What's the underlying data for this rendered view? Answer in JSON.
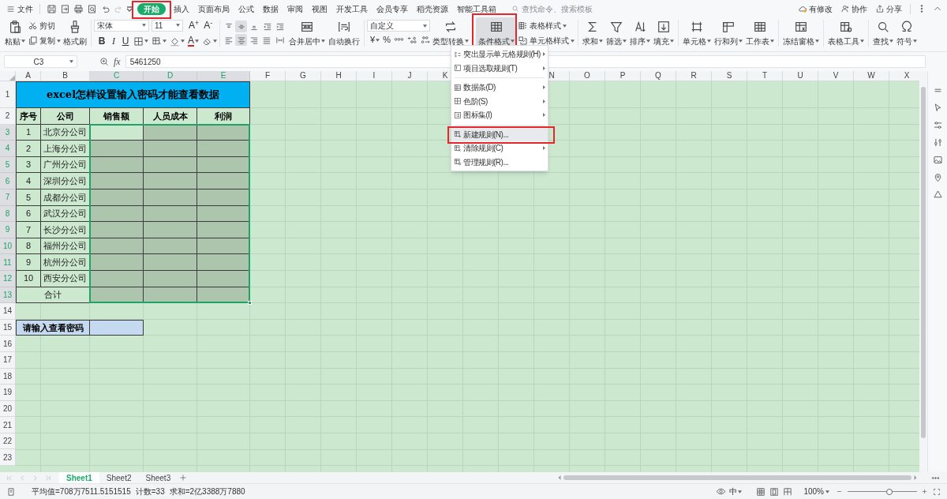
{
  "menu": {
    "file": "文件",
    "tabs": [
      {
        "label": "开始",
        "selected": true,
        "marked": true
      },
      {
        "label": "插入",
        "selected": false,
        "marked": false
      },
      {
        "label": "页面布局",
        "selected": false,
        "marked": false
      },
      {
        "label": "公式",
        "selected": false,
        "marked": false
      },
      {
        "label": "数据",
        "selected": false,
        "marked": false
      },
      {
        "label": "审阅",
        "selected": false,
        "marked": false
      },
      {
        "label": "视图",
        "selected": false,
        "marked": false
      },
      {
        "label": "开发工具",
        "selected": false,
        "marked": false
      },
      {
        "label": "会员专享",
        "selected": false,
        "marked": false
      },
      {
        "label": "稻壳资源",
        "selected": false,
        "marked": false
      },
      {
        "label": "智能工具箱",
        "selected": false,
        "marked": false
      }
    ],
    "search": {
      "placeholder": "查找命令、搜索模板"
    },
    "right": [
      "有修改",
      "协作",
      "分享"
    ]
  },
  "ribbon": {
    "paste": "粘贴",
    "cut": "剪切",
    "copy": "复制",
    "format_painter": "格式刷",
    "font": "宋体",
    "font_size": "11",
    "grow_font": "A$^{+}$",
    "shrink_font": "A$^{-}$",
    "bold": "B",
    "italic": "I",
    "underline": "U",
    "font_color": "A",
    "vertical_align": [
      {
        "selected": false
      },
      {
        "selected": true
      },
      {
        "selected": false
      }
    ],
    "horizontal_align": [
      {
        "selected": false
      },
      {
        "selected": true
      },
      {
        "selected": false
      },
      {
        "selected": false
      }
    ],
    "merge": "合并居中",
    "wrap": "自动换行",
    "number_format": "自定义",
    "currency": "¥",
    "percent": "%",
    "convert": "类型转换",
    "conditional": {
      "label": "条件格式",
      "expanded": true,
      "marked": true
    },
    "table_style": "表格样式",
    "cell_style": "单元格样式",
    "sum": "求和",
    "filter": "筛选",
    "sort": "排序",
    "fill": "填充",
    "cells": "单元格",
    "rows_cols": "行和列",
    "worksheet": "工作表",
    "freeze": "冻结窗格",
    "table_tools": "表格工具",
    "find": "查找",
    "symbol": "符号"
  },
  "formula_bar": {
    "name_box": "C3",
    "fx": "fx",
    "value": "5461250"
  },
  "sheet": {
    "columns": [
      {
        "kind": "column",
        "label": "A",
        "selected": false
      },
      {
        "kind": "column",
        "label": "B",
        "selected": false
      },
      {
        "kind": "column",
        "label": "C",
        "selected": true
      },
      {
        "kind": "column",
        "label": "D",
        "selected": true
      },
      {
        "kind": "column",
        "label": "E",
        "selected": true
      },
      {
        "kind": "column",
        "label": "F",
        "selected": false
      },
      {
        "kind": "column",
        "label": "G",
        "selected": false
      },
      {
        "kind": "column",
        "label": "H",
        "selected": false
      },
      {
        "kind": "column",
        "label": "I",
        "selected": false
      },
      {
        "kind": "column",
        "label": "J",
        "selected": false
      },
      {
        "kind": "column",
        "label": "K",
        "selected": false
      },
      {
        "kind": "covered"
      },
      {
        "kind": "covered"
      },
      {
        "kind": "column",
        "label": "N",
        "selected": false
      },
      {
        "kind": "column",
        "label": "O",
        "selected": false
      },
      {
        "kind": "column",
        "label": "P",
        "selected": false
      },
      {
        "kind": "column",
        "label": "Q",
        "selected": false
      },
      {
        "kind": "column",
        "label": "R",
        "selected": false
      },
      {
        "kind": "column",
        "label": "S",
        "selected": false
      },
      {
        "kind": "column",
        "label": "T",
        "selected": false
      },
      {
        "kind": "column",
        "label": "U",
        "selected": false
      },
      {
        "kind": "column",
        "label": "V",
        "selected": false
      },
      {
        "kind": "column",
        "label": "W",
        "selected": false
      },
      {
        "kind": "column",
        "label": "X",
        "selected": false
      }
    ],
    "rows": [
      {
        "label": "1",
        "selected": false
      },
      {
        "label": "2",
        "selected": false
      },
      {
        "label": "3",
        "selected": true
      },
      {
        "label": "4",
        "selected": true
      },
      {
        "label": "5",
        "selected": true
      },
      {
        "label": "6",
        "selected": true
      },
      {
        "label": "7",
        "selected": true
      },
      {
        "label": "8",
        "selected": true
      },
      {
        "label": "9",
        "selected": true
      },
      {
        "label": "10",
        "selected": true
      },
      {
        "label": "11",
        "selected": true
      },
      {
        "label": "12",
        "selected": true
      },
      {
        "label": "13",
        "selected": true
      },
      {
        "label": "14",
        "selected": false
      },
      {
        "label": "15",
        "selected": false
      },
      {
        "label": "16",
        "selected": false
      },
      {
        "label": "17",
        "selected": false
      },
      {
        "label": "18",
        "selected": false
      },
      {
        "label": "19",
        "selected": false
      },
      {
        "label": "20",
        "selected": false
      },
      {
        "label": "21",
        "selected": false
      },
      {
        "label": "22",
        "selected": false
      },
      {
        "label": "23",
        "selected": false
      }
    ],
    "title": "excel怎样设置输入密码才能查看数据",
    "headers": [
      "序号",
      "公司",
      "销售额",
      "人员成本",
      "利润"
    ],
    "records": [
      {
        "no": "1",
        "company": "北京分公司"
      },
      {
        "no": "2",
        "company": "上海分公司"
      },
      {
        "no": "3",
        "company": "广州分公司"
      },
      {
        "no": "4",
        "company": "深圳分公司"
      },
      {
        "no": "5",
        "company": "成都分公司"
      },
      {
        "no": "6",
        "company": "武汉分公司"
      },
      {
        "no": "7",
        "company": "长沙分公司"
      },
      {
        "no": "8",
        "company": "福州分公司"
      },
      {
        "no": "9",
        "company": "杭州分公司"
      },
      {
        "no": "10",
        "company": "西安分公司"
      }
    ],
    "total_label": "合计",
    "password_label": "请输入查看密码"
  },
  "context_menu": {
    "items": [
      {
        "kind": "item",
        "label": "突出显示单元格规则(H)",
        "submenu": true,
        "hovered": false,
        "marked": false
      },
      {
        "kind": "item",
        "label": "项目选取规则(T)",
        "submenu": true,
        "hovered": false,
        "marked": false
      },
      {
        "kind": "separator"
      },
      {
        "kind": "item",
        "label": "数据条(D)",
        "submenu": true,
        "hovered": false,
        "marked": false
      },
      {
        "kind": "item",
        "label": "色阶(S)",
        "submenu": true,
        "hovered": false,
        "marked": false
      },
      {
        "kind": "item",
        "label": "图标集(I)",
        "submenu": true,
        "hovered": false,
        "marked": false
      },
      {
        "kind": "separator"
      },
      {
        "kind": "item",
        "label": "新建规则(N)...",
        "submenu": false,
        "hovered": true,
        "marked": true
      },
      {
        "kind": "item",
        "label": "清除规则(C)",
        "submenu": true,
        "hovered": false,
        "marked": false
      },
      {
        "kind": "item",
        "label": "管理规则(R)...",
        "submenu": false,
        "hovered": false,
        "marked": false
      }
    ]
  },
  "sheet_tabs": [
    {
      "label": "Sheet1",
      "selected": true
    },
    {
      "label": "Sheet2",
      "selected": false
    },
    {
      "label": "Sheet3",
      "selected": false
    }
  ],
  "status_bar": {
    "stats": [
      "平均值=708万7511.5151515",
      "计数=33",
      "求和=2亿3388万7880"
    ],
    "input_mode": "中",
    "zoom": "100%",
    "zoom_slider": {
      "level": 0.6
    }
  }
}
